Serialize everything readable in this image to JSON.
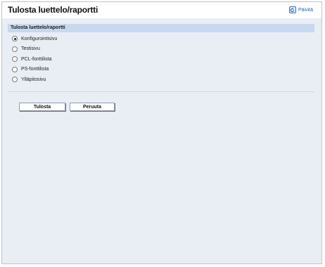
{
  "header": {
    "title": "Tulosta luettelo/raportti",
    "refresh_label": "Päivitä"
  },
  "section": {
    "title": "Tulosta luettelo/raportti"
  },
  "options": [
    {
      "label": "Konfigurointisivu",
      "selected": true
    },
    {
      "label": "Testisivu",
      "selected": false
    },
    {
      "label": "PCL-fonttilista",
      "selected": false
    },
    {
      "label": "PS-fonttilista",
      "selected": false
    },
    {
      "label": "Ylläpitosivu",
      "selected": false
    }
  ],
  "buttons": {
    "print_label": "Tulosta",
    "cancel_label": "Peruuta"
  }
}
